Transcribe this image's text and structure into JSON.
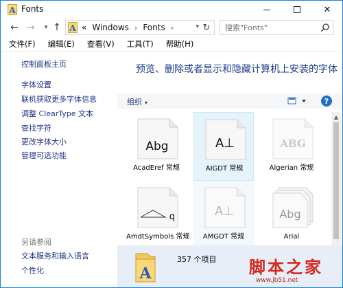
{
  "window": {
    "title": "Fonts",
    "controls": {
      "minimize": "",
      "maximize": "",
      "close": "✕"
    }
  },
  "address_bar": {
    "back": "←",
    "forward": "→",
    "history_dropdown": "▾",
    "up": "↑",
    "overflow": "«",
    "path": [
      "Windows",
      "Fonts"
    ],
    "separator": "›",
    "dropdown": "▾",
    "refresh": "↻"
  },
  "search": {
    "placeholder": "搜索\"Fonts\""
  },
  "menu": {
    "file": "文件(F)",
    "edit": "编辑(E)",
    "view": "查看(V)",
    "tools": "工具(T)",
    "help": "帮助(H)"
  },
  "left_pane": {
    "home": "控制面板主页",
    "links": [
      "字体设置",
      "联机获取更多字体信息",
      "调整 ClearType 文本",
      "查找字符",
      "更改字体大小",
      "管理可选功能"
    ],
    "see_also": "另请参阅",
    "see_also_links": [
      "文本服务和输入语言",
      "个性化"
    ]
  },
  "main": {
    "heading": "预览、删除或者显示和隐藏计算机上安装的字体",
    "organize": "组织",
    "organize_caret": "▾",
    "help": "?"
  },
  "fonts": [
    {
      "label": "AcadEref 常规",
      "preview": "Abg"
    },
    {
      "label": "AIGDT 常规",
      "preview": "A⊥"
    },
    {
      "label": "Algerian 常规",
      "preview": "ABG"
    },
    {
      "label": "AmdtSymbols 常规",
      "preview": "q"
    },
    {
      "label": "AMGDT 常规",
      "preview": "A⊥"
    },
    {
      "label": "Arial",
      "preview": "Abg"
    }
  ],
  "status": {
    "count": "357 个项目"
  },
  "watermark": {
    "title": "脚本之家",
    "url": "www.jb51.net"
  },
  "colors": {
    "link": "#1e3287",
    "heading": "#1e3f8a",
    "selection": "#e5f3fb",
    "status_bg": "#e7eef8",
    "watermark": "#d7281f",
    "window_border": "#1883d7"
  }
}
